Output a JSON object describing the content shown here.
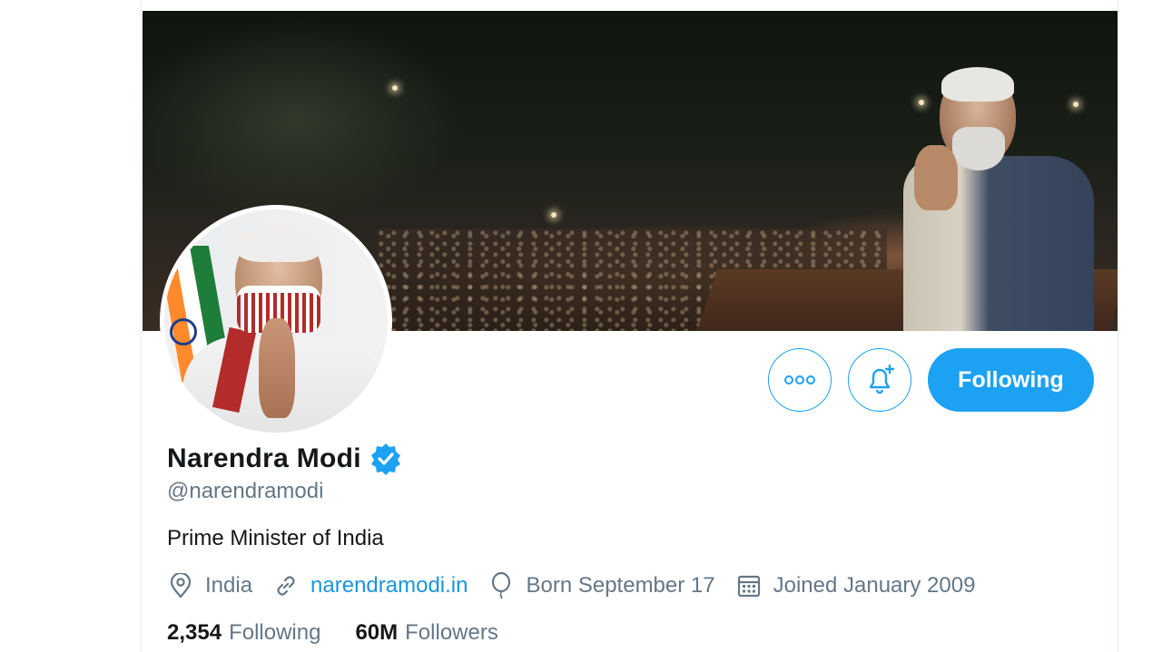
{
  "profile": {
    "display_name": "Narendra Modi",
    "handle": "@narendramodi",
    "bio": "Prime Minister of India",
    "verified": true,
    "location": "India",
    "website": "narendramodi.in",
    "birthday": "Born September 17",
    "joined": "Joined January 2009"
  },
  "stats": {
    "following_count": "2,354",
    "following_label": "Following",
    "followers_count": "60M",
    "followers_label": "Followers"
  },
  "actions": {
    "following_button": "Following",
    "more_icon": "more-horizontal-icon",
    "notify_icon": "bell-plus-icon"
  },
  "icons": {
    "location": "location-pin-icon",
    "website": "link-icon",
    "birthday": "balloon-icon",
    "joined": "calendar-icon",
    "verified": "verified-badge-icon"
  },
  "colors": {
    "accent": "#1da1f2",
    "link": "#1b95e0",
    "primary_text": "#14171a",
    "secondary_text": "#657786"
  }
}
